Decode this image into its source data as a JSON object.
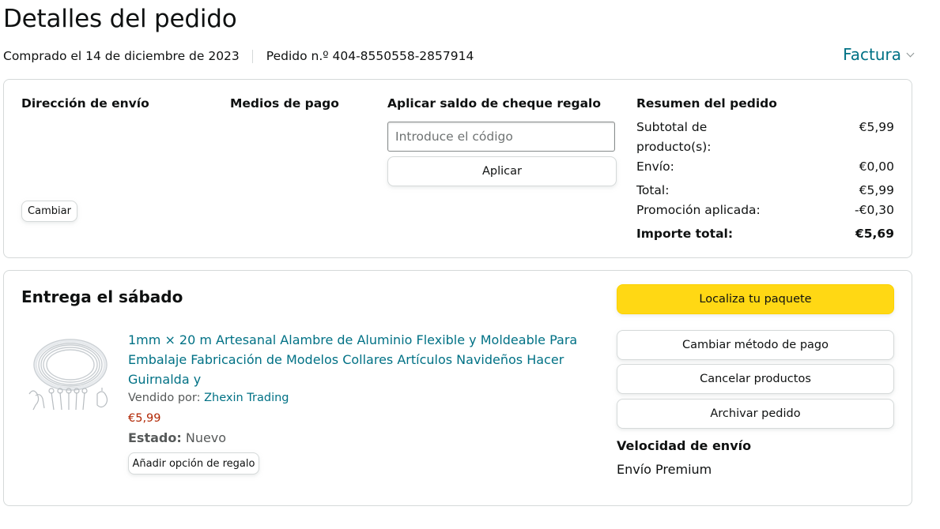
{
  "header": {
    "title": "Detalles del pedido",
    "purchased": "Comprado el 14 de diciembre de 2023",
    "order_number": "Pedido n.º 404-8550558-2857914",
    "invoice_label": "Factura"
  },
  "summary_card": {
    "shipping_address_heading": "Dirección de envío",
    "payment_methods_heading": "Medios de pago",
    "gift_card_heading": "Aplicar saldo de cheque regalo",
    "gift_card_placeholder": "Introduce el código",
    "apply_label": "Aplicar",
    "change_label": "Cambiar",
    "order_summary_heading": "Resumen del pedido",
    "rows": [
      {
        "label": "Subtotal de producto(s):",
        "value": "€5,99"
      },
      {
        "label": "Envío:",
        "value": "€0,00"
      },
      {
        "label": "Total:",
        "value": "€5,99"
      },
      {
        "label": "Promoción aplicada:",
        "value": "-€0,30"
      },
      {
        "label": "Importe total:",
        "value": "€5,69"
      }
    ]
  },
  "delivery_card": {
    "title": "Entrega el sábado",
    "product": {
      "title": "1mm × 20 m Artesanal Alambre de Aluminio Flexible y Moldeable Para Embalaje Fabricación de Modelos Collares Artículos Navideños Hacer Guirnalda y",
      "sold_by_label": "Vendido por:",
      "seller": "Zhexin Trading",
      "price": "€5,99",
      "condition_label": "Estado:",
      "condition_value": "Nuevo",
      "gift_option_label": "Añadir opción de regalo"
    },
    "actions": {
      "track": "Localiza tu paquete",
      "change_payment": "Cambiar método de pago",
      "cancel_items": "Cancelar productos",
      "archive": "Archivar pedido"
    },
    "shipping_speed_heading": "Velocidad de envío",
    "shipping_speed_value": "Envío Premium"
  },
  "colors": {
    "link": "#007185",
    "price": "#b12704",
    "primary_button": "#ffd814",
    "border": "#d5d9d9"
  }
}
